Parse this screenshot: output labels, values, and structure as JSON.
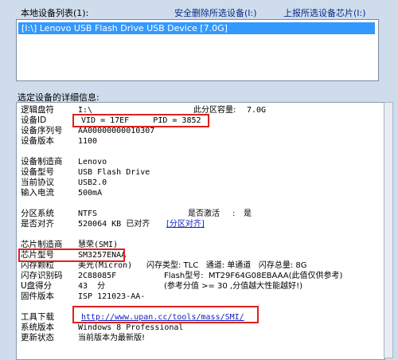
{
  "header": {
    "list_title": "本地设备列表(1):",
    "eject_link": "安全删除所选设备(I:)",
    "report_link": "上报所选设备芯片(I:)"
  },
  "device_list": {
    "items": [
      "[I:\\] Lenovo USB Flash Drive USB Device [7.0G]"
    ]
  },
  "details": {
    "title": "选定设备的详细信息:",
    "drive_letter": {
      "label": "逻辑盘符",
      "value": "I:\\",
      "extra_label": "此分区容量:",
      "extra_value": "7.0G"
    },
    "device_id": {
      "label": "设备ID",
      "value": "VID = 17EF     PID = 3852"
    },
    "serial": {
      "label": "设备序列号",
      "value": "AA00000000010307"
    },
    "version": {
      "label": "设备版本",
      "value": "1100"
    },
    "vendor": {
      "label": "设备制造商",
      "value": "Lenovo"
    },
    "model": {
      "label": "设备型号",
      "value": "USB Flash Drive"
    },
    "protocol": {
      "label": "当前协议",
      "value": "USB2.0"
    },
    "current": {
      "label": "输入电流",
      "value": "500mA"
    },
    "fs": {
      "label": "分区系统",
      "value": "NTFS",
      "active_label": "是否激活",
      "active_value": "是"
    },
    "align": {
      "label": "是否对齐",
      "value": "520064 KB 已对齐",
      "link": "[分区对齐]"
    },
    "chip_vendor": {
      "label": "芯片制造商",
      "value": "慧荣(SMI)"
    },
    "chip_model": {
      "label": "芯片型号",
      "value": "SM3257ENAA"
    },
    "flash_vendor": {
      "label": "闪存颗粒",
      "value": "美光(Micron)",
      "rest": "闪存类型: TLC   通道: 单通道   闪存总量: 8G"
    },
    "flash_id": {
      "label": "闪存识别码",
      "value": "2C88085F",
      "rest": "Flash型号:  MT29F64G08EBAAA(此值仅供参考)"
    },
    "grade": {
      "label": "U盘得分",
      "value": "43  分",
      "rest": "(参考分值 >= 30 ,分值越大性能越好!)"
    },
    "firmware": {
      "label": "固件版本",
      "value": "ISP 121023-AA-"
    },
    "tool": {
      "label": "工具下载",
      "link": "http://www.upan.cc/tools/mass/SMI/"
    },
    "os": {
      "label": "系统版本",
      "value": "Windows 8 Professional"
    },
    "update": {
      "label": "更新状态",
      "value": "当前版本为最新版!"
    }
  },
  "colors": {
    "highlight": "#e02020",
    "selection": "#3399ff",
    "link": "#1020c0"
  }
}
